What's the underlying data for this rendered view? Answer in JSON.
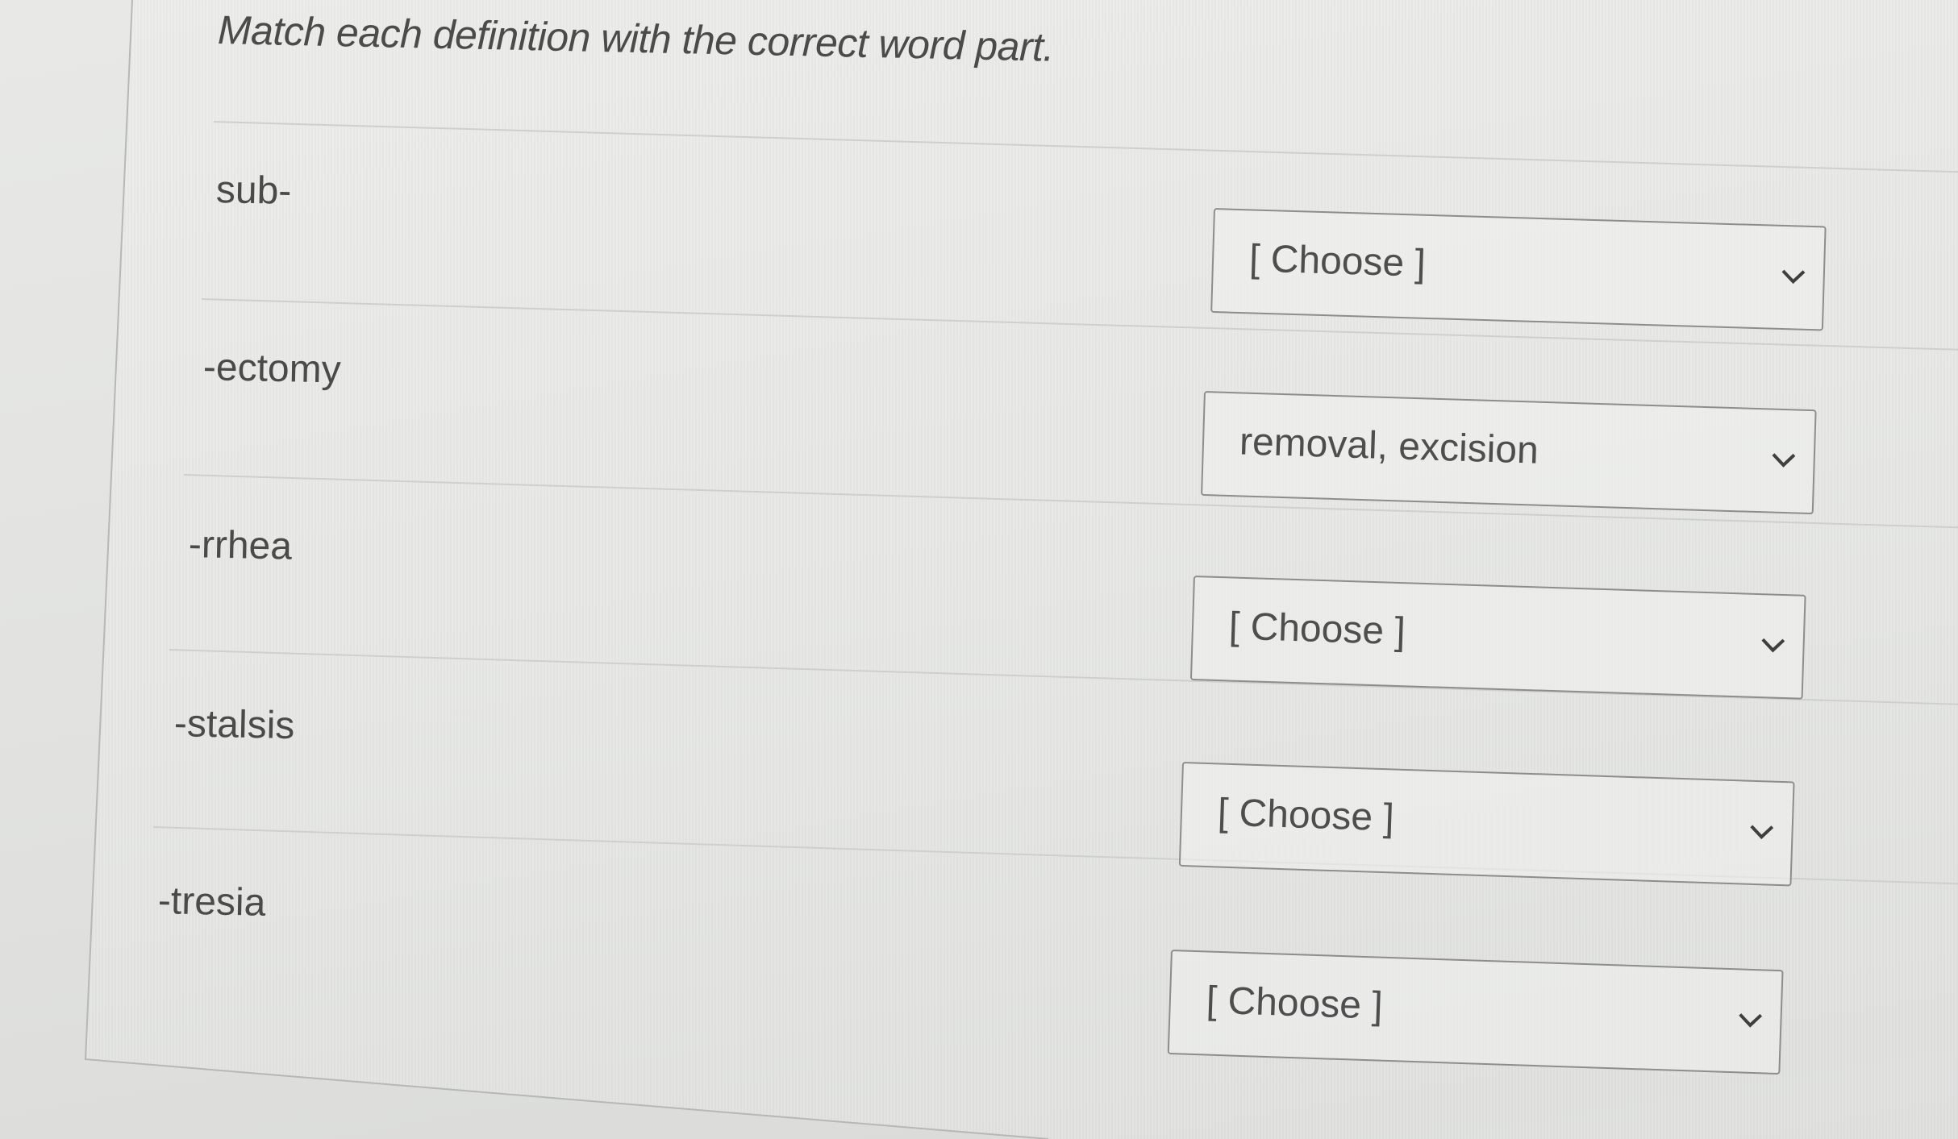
{
  "instructions": "Match each definition with the correct word part.",
  "rows": [
    {
      "term": "sub-",
      "selected": "[ Choose ]"
    },
    {
      "term": "-ectomy",
      "selected": "removal, excision"
    },
    {
      "term": "-rrhea",
      "selected": "[ Choose ]"
    },
    {
      "term": "-stalsis",
      "selected": "[ Choose ]"
    },
    {
      "term": "-tresia",
      "selected": "[ Choose ]"
    }
  ],
  "icons": {
    "dropdown": "chevron-down-icon"
  }
}
